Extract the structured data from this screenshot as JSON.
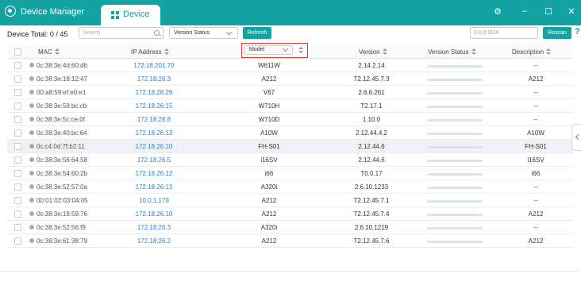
{
  "window": {
    "title": "Device Manager",
    "active_tab": "Device"
  },
  "toolbar": {
    "device_total": "Device Total: 0 / 45",
    "search_placeholder": "Search",
    "version_status_select": "Version Status",
    "refresh_label": "Refresh",
    "ip_range": "0.0.0.0/24",
    "rescan_label": "Rescan",
    "help_label": "?"
  },
  "table": {
    "headers": {
      "mac": "MAC",
      "ip": "IP Address",
      "model": "Model",
      "version": "Version",
      "version_status": "Version Status",
      "description": "Description"
    },
    "rows": [
      {
        "mac": "0c:38:3e:4d:60:db",
        "ip": "172.18.201.70",
        "model": "W611W",
        "version": "2.14.2.14",
        "description": "--"
      },
      {
        "mac": "0c:38:3e:18:12:47",
        "ip": "172.18.26.3",
        "model": "A212",
        "version": "T2.12.45.7.3",
        "description": "A212"
      },
      {
        "mac": "00:a8:59:ef:e0:e1",
        "ip": "172.18.28.29",
        "model": "V67",
        "version": "2.6.6.261",
        "description": "--"
      },
      {
        "mac": "0c:38:3e:59:bc:cb",
        "ip": "172.18.26.15",
        "model": "W710H",
        "version": "T2.17.1",
        "description": "--"
      },
      {
        "mac": "0c:38:3e:5c:ce:0f",
        "ip": "172.18.28.8",
        "model": "W710D",
        "version": "1.10.0",
        "description": "--"
      },
      {
        "mac": "0c:38:3e:40:bc:64",
        "ip": "172.18.26.13",
        "model": "A10W",
        "version": "2.12.44.4.2",
        "description": "A10W"
      },
      {
        "mac": "0c:c4:0d:7f:b2:11",
        "ip": "172.18.26.10",
        "model": "FH-S01",
        "version": "2.12.44.6",
        "description": "FH-S01"
      },
      {
        "mac": "0c:38:3e:56:64:58",
        "ip": "172.18.26.5",
        "model": "i16SV",
        "version": "2.12.44.6",
        "description": "i16SV"
      },
      {
        "mac": "0c:38:3e:54:60:2b",
        "ip": "172.18.26.12",
        "model": "i66",
        "version": "T0.0.17",
        "description": "i66"
      },
      {
        "mac": "0c:38:3e:52:57:0a",
        "ip": "172.18.26.13",
        "model": "A320i",
        "version": "2.6.10.1233",
        "description": "--"
      },
      {
        "mac": "00:01:02:03:04:05",
        "ip": "10.0.1.179",
        "model": "A212",
        "version": "T2.12.45.7.1",
        "description": "--"
      },
      {
        "mac": "0c:38:3e:18:59:76",
        "ip": "172.18.26.10",
        "model": "A212",
        "version": "T2.12.45.7.4",
        "description": "A212"
      },
      {
        "mac": "0c:38:3e:52:56:f9",
        "ip": "172.18.26.3",
        "model": "A320i",
        "version": "2.6.10.1219",
        "description": "--"
      },
      {
        "mac": "0c:38:3e:61:38:79",
        "ip": "172.18.26.2",
        "model": "A212",
        "version": "T2.12.45.7.6",
        "description": "A212"
      }
    ]
  },
  "colors": {
    "accent": "#14a3a3",
    "link": "#2e7fd0",
    "highlight_border": "#e53935"
  }
}
